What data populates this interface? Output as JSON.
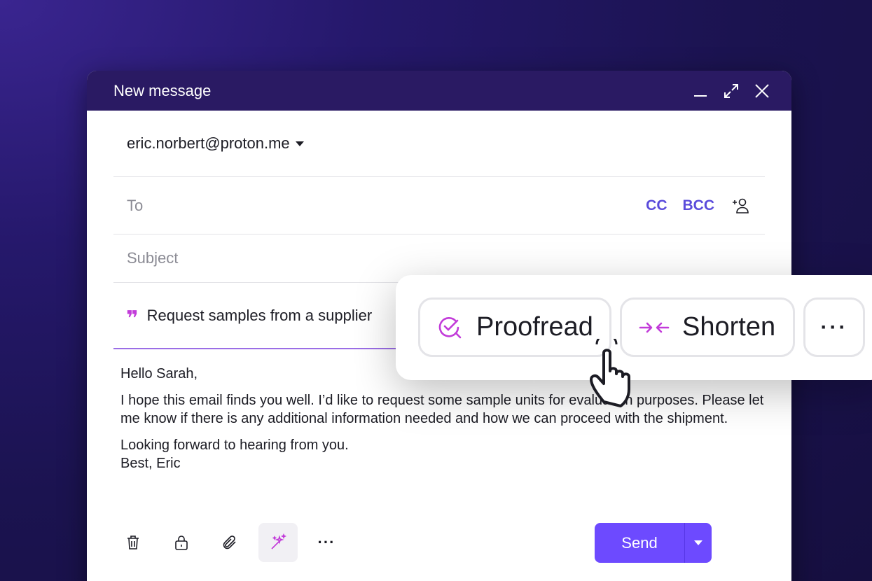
{
  "window": {
    "title": "New message",
    "controls": {
      "minimize": "minimize-icon",
      "maximize": "maximize-icon",
      "close": "close-icon"
    }
  },
  "compose": {
    "from": "eric.norbert@proton.me",
    "to_placeholder": "To",
    "cc_label": "CC",
    "bcc_label": "BCC",
    "subject_placeholder": "Subject",
    "ai_prompt": "Request samples from a supplier",
    "body": {
      "greeting": "Hello Sarah,",
      "paragraph1": "I hope this email finds you well. I’d like to request some sample units for evaluation purposes. Please let me know if there is any additional information needed and how we can proceed with the shipment.",
      "closing_line": "Looking forward to hearing from you.",
      "signature": "Best, Eric"
    }
  },
  "toolbar": {
    "icons": [
      "trash-icon",
      "lock-icon",
      "paperclip-icon",
      "magic-wand-icon",
      "more-icon"
    ],
    "more_label": "···",
    "send_label": "Send"
  },
  "ai_actions": {
    "proofread_label": "Proofread",
    "shorten_label": "Shorten",
    "more_label": "···"
  },
  "colors": {
    "accent": "#6d4aff",
    "titlebar": "#2a1a63",
    "link": "#5b4cdb",
    "ai_accent": "#c23bd9"
  }
}
